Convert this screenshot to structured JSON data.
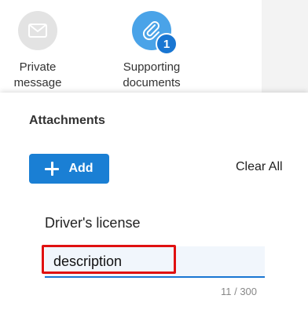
{
  "actions": {
    "private_message": {
      "label": "Private\nmessage",
      "icon": "envelope-icon"
    },
    "supporting_documents": {
      "label": "Supporting\ndocuments",
      "icon": "paperclip-icon",
      "badge": "1"
    }
  },
  "attachments": {
    "title": "Attachments",
    "add_label": "Add",
    "clear_all_label": "Clear All",
    "item": {
      "title": "Driver's license",
      "description_value": "description",
      "counter": "11 / 300"
    }
  },
  "colors": {
    "primary": "#1a7fd4",
    "badge": "#1976d2",
    "icon_bg_active": "#4aa3e8",
    "icon_bg_inactive": "#e3e3e3",
    "highlight": "#e01010"
  }
}
